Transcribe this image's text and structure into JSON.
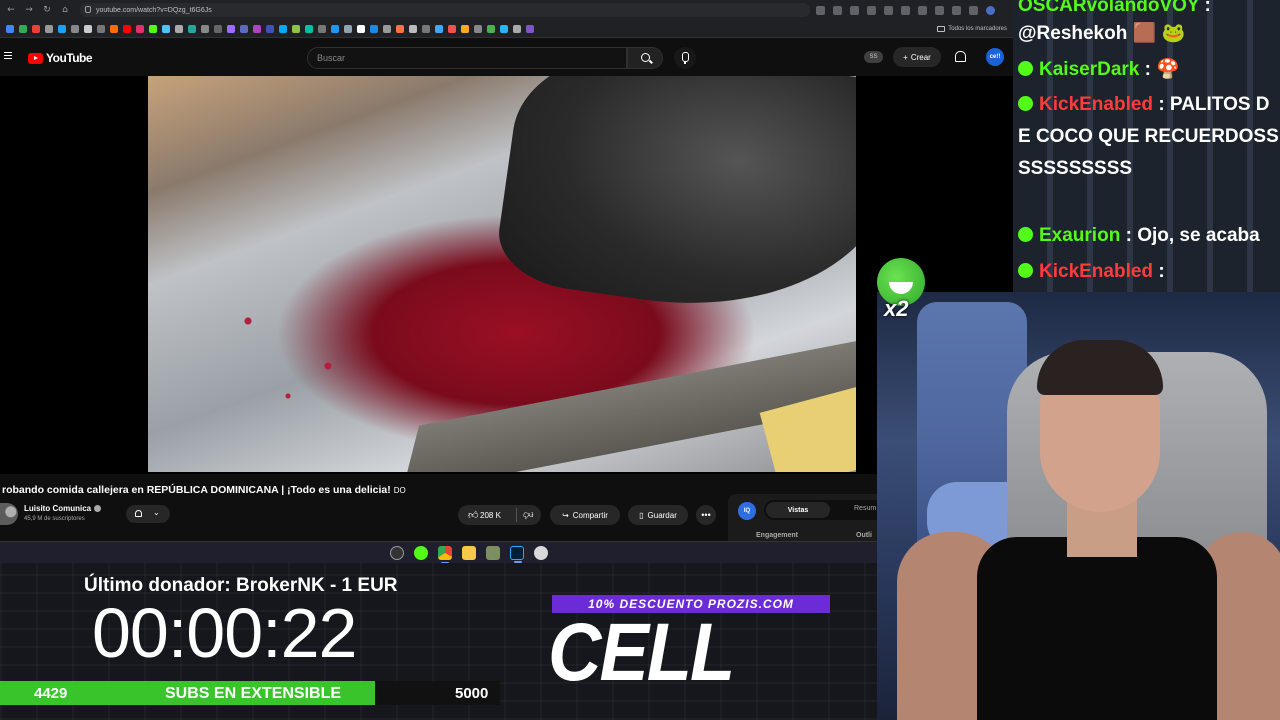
{
  "browser": {
    "url": "youtube.com/watch?v=DQzg_t6G6Js",
    "bookmarks_folder": "Todos los marcadores"
  },
  "youtube": {
    "logo_text": "YouTube",
    "search_placeholder": "Buscar",
    "ss_badge": "SS",
    "create_label": "Crear",
    "avatar_text": "ce!!"
  },
  "video": {
    "title": "robando comida callejera en REPÚBLICA DOMINICANA | ¡Todo es una delicia!",
    "title_suffix": "DO",
    "channel_name": "Luisito Comunica",
    "channel_subs": "45,9 M de suscriptores",
    "likes": "208 K",
    "share_label": "Compartir",
    "save_label": "Guardar",
    "more_label": "•••"
  },
  "extension_panel": {
    "logo": "IQ",
    "tab_active": "Vistas",
    "tab_other": "Resum",
    "label_left": "Engagement",
    "label_right": "Outli"
  },
  "overlay": {
    "donor_text": "Último donador: BrokerNK - 1 EUR",
    "timer": "00:00:22",
    "subs_current": "4429",
    "subs_label": "SUBS EN EXTENSIBLE",
    "subs_goal": "5000",
    "subs_progress": 0.75,
    "promo_text": "10% DESCUENTO PROZIS.COM",
    "brand_text": "CELL"
  },
  "chat": {
    "messages": [
      {
        "user": "OSCARvolandoVOY",
        "text": ":",
        "color": "green"
      },
      {
        "user": "",
        "text": "@Reshekoh 🟫 🐸",
        "color": "white"
      },
      {
        "user": "KaiserDark",
        "text": ": 🍄",
        "color": "green"
      },
      {
        "user": "KickEnabled",
        "text": ": PALITOS DE COCO QUE RECUERDOSSSSSSSSSSS",
        "color": "red"
      },
      {
        "user": "Exaurion",
        "text": ": Ojo, se acaba",
        "color": "green"
      },
      {
        "user": "KickEnabled",
        "text": ":",
        "color": "red"
      }
    ]
  },
  "emote": {
    "multiplier": "x2"
  },
  "colors": {
    "kick_green": "#53fc18",
    "kick_red": "#ff3b3b",
    "youtube_red": "#ff0000",
    "promo_purple": "#6b2bd6",
    "subs_bar_green": "#3ac42c"
  }
}
